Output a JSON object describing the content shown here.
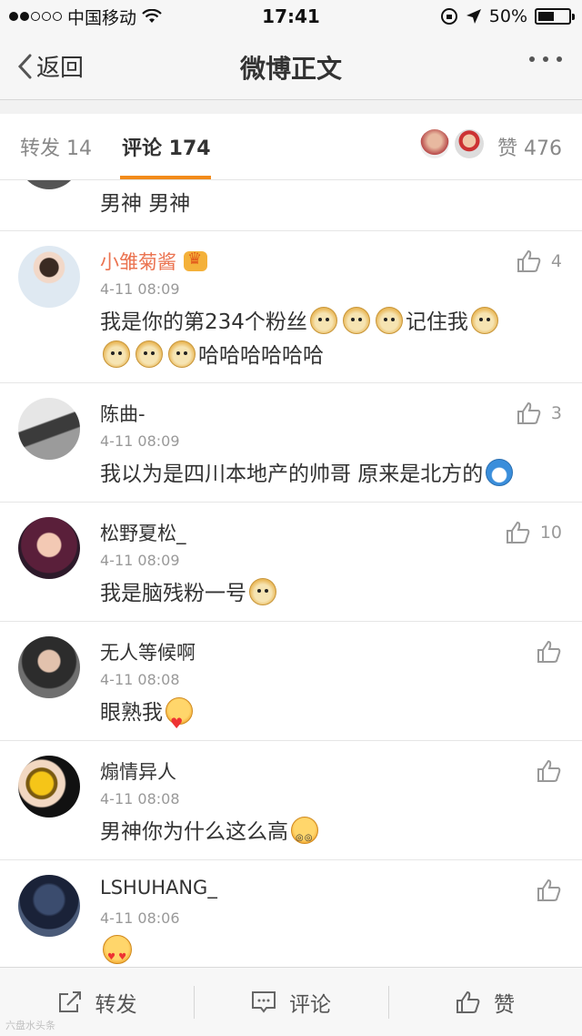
{
  "status_bar": {
    "carrier": "中国移动",
    "time": "17:41",
    "battery": "50%"
  },
  "nav": {
    "back_label": "返回",
    "title": "微博正文"
  },
  "tabs": {
    "repost": "转发 14",
    "comment": "评论 174",
    "likes": "赞 476"
  },
  "comments": [
    {
      "text": "男神 男神"
    },
    {
      "name": "小雏菊酱",
      "time": "4-11 08:09",
      "text_a": "我是你的第234个粉丝",
      "text_b": "记住我",
      "text_c": "哈哈哈哈哈哈",
      "likes": "4"
    },
    {
      "name": "陈曲-",
      "time": "4-11 08:09",
      "text": "我以为是四川本地产的帅哥 原来是北方的",
      "likes": "3"
    },
    {
      "name": "松野夏松_",
      "time": "4-11 08:09",
      "text": "我是脑残粉一号",
      "likes": "10"
    },
    {
      "name": "无人等候啊",
      "time": "4-11 08:08",
      "text": "眼熟我"
    },
    {
      "name": "煽情异人",
      "time": "4-11 08:08",
      "text": "男神你为什么这么高"
    },
    {
      "name": "LSHUHANG_",
      "time": "4-11 08:06"
    }
  ],
  "toolbar": {
    "repost": "转发",
    "comment": "评论",
    "like": "赞"
  },
  "watermark": "六盘水头条",
  "colors": {
    "accent": "#f28b1a",
    "vip_name": "#eb7350"
  }
}
